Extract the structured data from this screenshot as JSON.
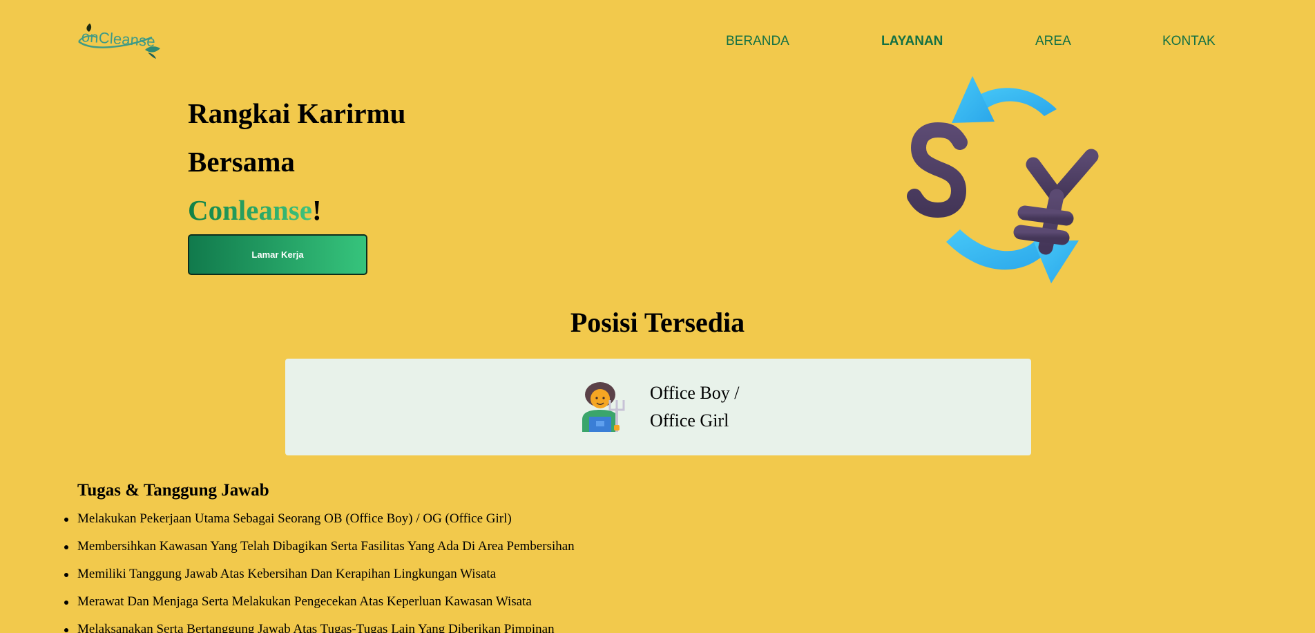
{
  "header": {
    "logo_text": "onCleanse",
    "nav": [
      {
        "label": "BERANDA",
        "active": false
      },
      {
        "label": "LAYANAN",
        "active": true
      },
      {
        "label": "AREA",
        "active": false
      },
      {
        "label": "KONTAK",
        "active": false
      }
    ]
  },
  "hero": {
    "line1": "Rangkai Karirmu",
    "line2": "Bersama",
    "brand": "Conleanse",
    "brand_suffix": "!",
    "cta_label": "Lamar Kerja",
    "illustration_icon": "currency-exchange-icon"
  },
  "positions": {
    "title": "Posisi Tersedia",
    "items": [
      {
        "icon": "farmer-worker-icon",
        "title_line1": "Office Boy /",
        "title_line2": "Office Girl"
      }
    ]
  },
  "duties": {
    "title": "Tugas & Tanggung Jawab",
    "items": [
      "Melakukan Pekerjaan Utama Sebagai Seorang OB (Office Boy) / OG (Office Girl)",
      "Membersihkan Kawasan Yang Telah Dibagikan Serta Fasilitas Yang Ada Di Area Pembersihan",
      "Memiliki Tanggung Jawab Atas Kebersihan Dan Kerapihan Lingkungan Wisata",
      "Merawat Dan Menjaga Serta Melakukan Pengecekan Atas Keperluan Kawasan Wisata",
      "Melaksanakan Serta Bertanggung Jawab Atas Tugas-Tugas Lain Yang Diberikan Pimpinan"
    ]
  },
  "colors": {
    "background": "#f2c94c",
    "nav_text": "#137044",
    "brand_gradient_start": "#128045",
    "brand_gradient_end": "#3fc47e",
    "card_background": "#e8f2ea",
    "arrow_blue": "#3dbcf5",
    "currency_purple": "#4e3f63"
  }
}
